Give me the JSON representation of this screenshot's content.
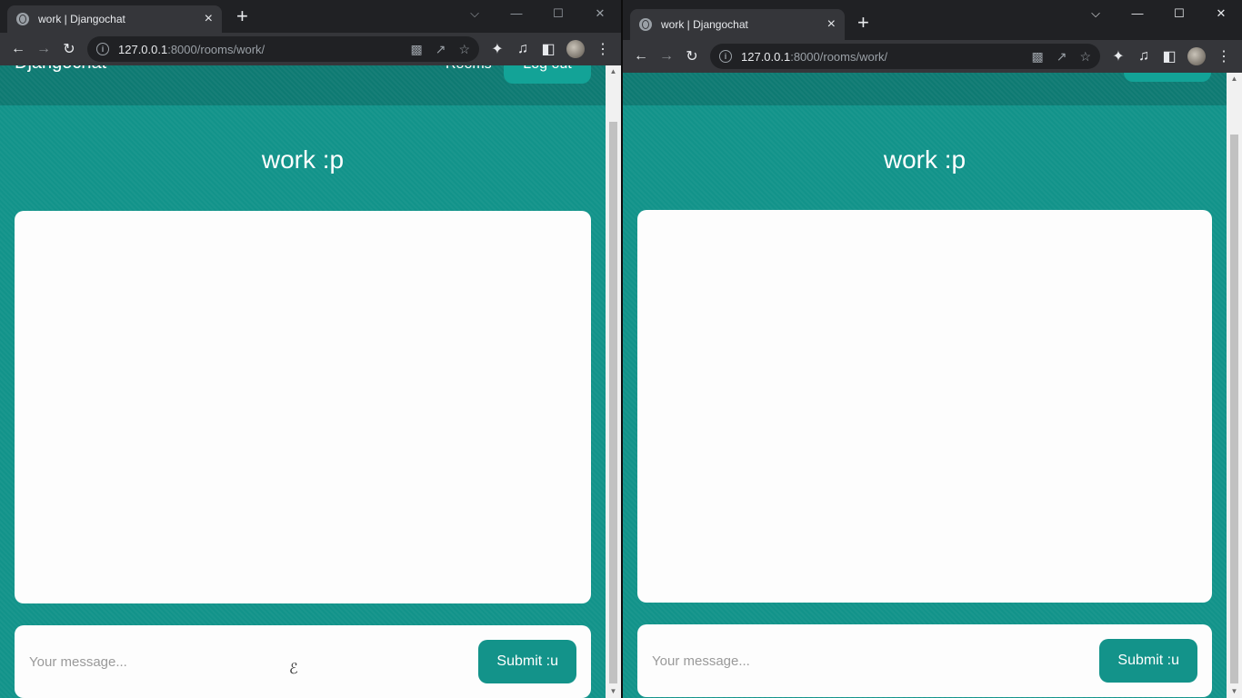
{
  "browser": {
    "tab_title": "work | Djangochat",
    "tab_close": "×",
    "new_tab": "+",
    "url_host": "127.0.0.1",
    "url_rest": ":8000/rooms/work/",
    "window_controls": {
      "collapse": "⌵",
      "minimize": "—",
      "maximize": "☐",
      "close": "✕"
    }
  },
  "navbar": {
    "brand": "Djangochat",
    "rooms_link": "Rooms",
    "logout": "Log out"
  },
  "room": {
    "title": "work :p"
  },
  "composer": {
    "placeholder": "Your message...",
    "submit_label": "Submit :u"
  },
  "colors": {
    "page_bg": "#12938a",
    "navbar_bg": "#0e7a72",
    "button": "#13938a",
    "panel": "#fdfdfd"
  }
}
